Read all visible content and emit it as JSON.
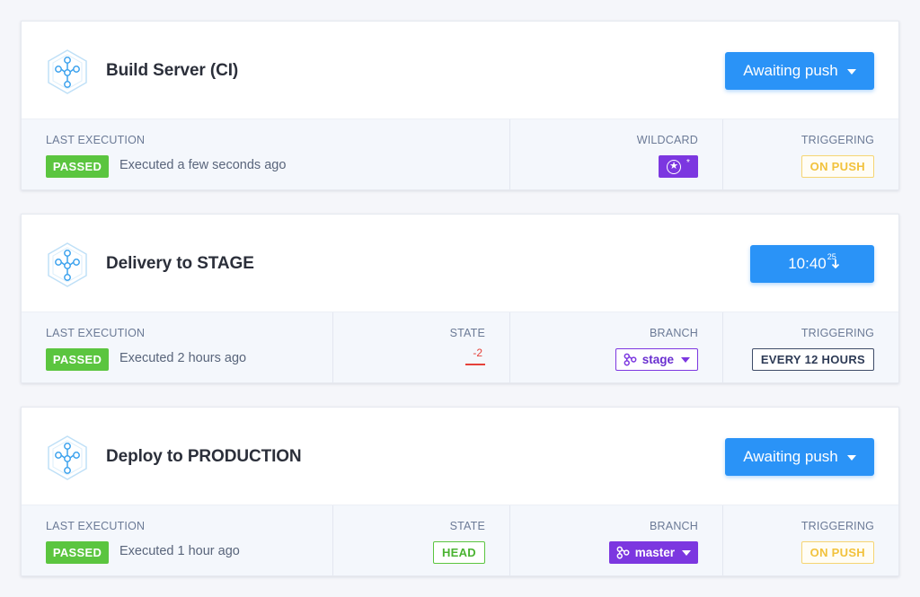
{
  "colors": {
    "accent_blue": "#2a93f7",
    "passed_green": "#5bc53f",
    "branch_purple": "#7c37e0",
    "on_push_yellow": "#f2c23c",
    "state_red": "#e5413a",
    "label_gray": "#6b7a96"
  },
  "pipelines": [
    {
      "icon": "pipeline-hex-icon",
      "title": "Build Server (CI)",
      "action": {
        "label": "Awaiting push"
      },
      "last_execution": {
        "label": "LAST EXECUTION",
        "status": "PASSED",
        "text": "Executed a few seconds ago"
      },
      "wildcard": {
        "label": "WILDCARD",
        "value": "*"
      },
      "triggering": {
        "label": "TRIGGERING",
        "value": "ON PUSH"
      }
    },
    {
      "icon": "pipeline-hex-icon",
      "title": "Delivery to STAGE",
      "action": {
        "time": "10:40",
        "sup": "25"
      },
      "last_execution": {
        "label": "LAST EXECUTION",
        "status": "PASSED",
        "text": "Executed 2 hours ago"
      },
      "state": {
        "label": "STATE",
        "value": "-2"
      },
      "branch": {
        "label": "BRANCH",
        "value": "stage"
      },
      "triggering": {
        "label": "TRIGGERING",
        "value": "EVERY 12 HOURS"
      }
    },
    {
      "icon": "pipeline-hex-icon",
      "title": "Deploy to PRODUCTION",
      "action": {
        "label": "Awaiting push"
      },
      "last_execution": {
        "label": "LAST EXECUTION",
        "status": "PASSED",
        "text": "Executed 1 hour ago"
      },
      "state": {
        "label": "STATE",
        "value": "HEAD"
      },
      "branch": {
        "label": "BRANCH",
        "value": "master"
      },
      "triggering": {
        "label": "TRIGGERING",
        "value": "ON PUSH"
      }
    }
  ]
}
